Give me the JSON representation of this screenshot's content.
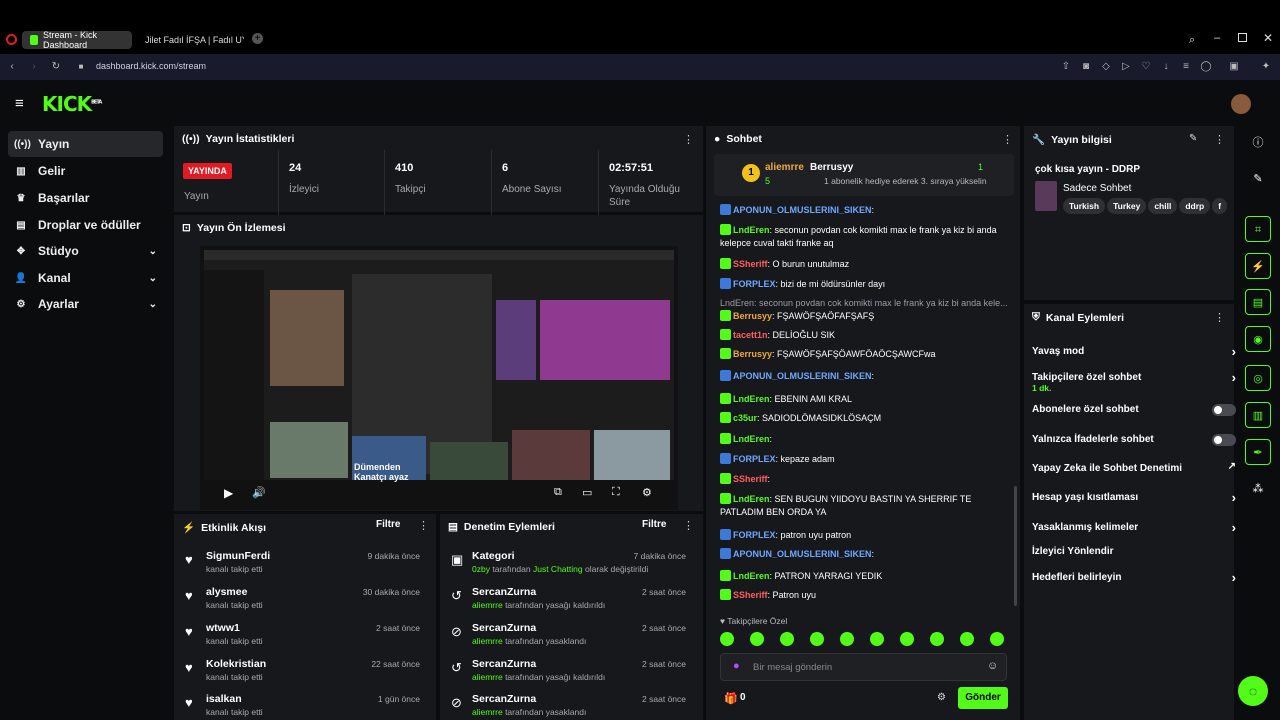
{
  "browser": {
    "tabs": [
      {
        "label": "Stream - Kick Dashboard"
      },
      {
        "label": "Jilet Fadıl İFŞA | Fadıl UYU"
      }
    ],
    "url_host": "dashboard.kick.com",
    "url_path": "/stream"
  },
  "sidebar": {
    "items": [
      {
        "label": "Yayın"
      },
      {
        "label": "Gelir"
      },
      {
        "label": "Başarılar"
      },
      {
        "label": "Droplar ve ödüller"
      },
      {
        "label": "Stüdyo"
      },
      {
        "label": "Kanal"
      },
      {
        "label": "Ayarlar"
      }
    ]
  },
  "logo": {
    "text": "KICK",
    "sup": "BETA"
  },
  "stats": {
    "title": "Yayın İstatistikleri",
    "live_badge": "YAYINDA",
    "items": [
      {
        "value": "",
        "label": "Yayın"
      },
      {
        "value": "24",
        "label": "İzleyici"
      },
      {
        "value": "410",
        "label": "Takipçi"
      },
      {
        "value": "6",
        "label": "Abone Sayısı"
      },
      {
        "value": "02:57:51",
        "label": "Yayında Olduğu Süre"
      }
    ]
  },
  "preview": {
    "title": "Yayın Ön İzlemesi",
    "overlay_text": "Dümenden Kanatçı ayaz"
  },
  "activity": {
    "title": "Etkinlik Akışı",
    "filter": "Filtre",
    "items": [
      {
        "name": "SigmunFerdi",
        "sub": "kanalı takip etti",
        "time": "9 dakika önce"
      },
      {
        "name": "alysmee",
        "sub": "kanalı takip etti",
        "time": "30 dakika önce"
      },
      {
        "name": "wtww1",
        "sub": "kanalı takip etti",
        "time": "2 saat önce"
      },
      {
        "name": "Kolekristian",
        "sub": "kanalı takip etti",
        "time": "22 saat önce"
      },
      {
        "name": "isalkan",
        "sub": "kanalı takip etti",
        "time": "1 gün önce"
      }
    ]
  },
  "moderation": {
    "title": "Denetim Eylemleri",
    "filter": "Filtre",
    "items": [
      {
        "name": "Kategori",
        "who": "0zby",
        "mid": " tarafından ",
        "what": "Just Chatting",
        "tail": " olarak değiştirildi",
        "time": "7 dakika önce"
      },
      {
        "name": "SercanZurna",
        "who": "aliemrre",
        "mid": " tarafından yasağı kaldırıldı",
        "what": "",
        "tail": "",
        "time": "2 saat önce"
      },
      {
        "name": "SercanZurna",
        "who": "aliemrre",
        "mid": " tarafından yasaklandı",
        "what": "",
        "tail": "",
        "time": "2 saat önce"
      },
      {
        "name": "SercanZurna",
        "who": "aliemrre",
        "mid": " tarafından yasağı kaldırıldı",
        "what": "",
        "tail": "",
        "time": "2 saat önce"
      },
      {
        "name": "SercanZurna",
        "who": "aliemrre",
        "mid": " tarafından yasaklandı",
        "what": "",
        "tail": "",
        "time": "2 saat önce"
      }
    ]
  },
  "chat": {
    "title": "Sohbet",
    "pinned": {
      "rank": "1",
      "user1": "aliemrre",
      "count1": "5",
      "user2": "Berrusyy",
      "count2": "1",
      "note": "1 abonelik hediye ederek 3. sıraya yükselin"
    },
    "messages": [
      {
        "user": "APONUN_OLMUSLERINI_SIKEN",
        "text": "",
        "color": "b"
      },
      {
        "user": "LndEren",
        "text": "seconun povdan cok komikti max le frank ya kiz bi anda kelepce cuval takti franke aq",
        "color": "g"
      },
      {
        "user": "SSheriff",
        "text": "O burun unutulmaz",
        "color": "r"
      },
      {
        "user": "FORPLEX",
        "text": "bizi de mi öldürsünler dayı",
        "color": "b"
      },
      {
        "user": "",
        "text": "LndEren: seconun povdan cok komikti max le frank ya kiz bi anda kele...",
        "color": "gr"
      },
      {
        "user": "Berrusyy",
        "text": "FŞAWÖFŞAÖFAFŞAFŞ",
        "color": "o"
      },
      {
        "user": "tacett1n",
        "text": "DELİOĞLU SIK",
        "color": "r"
      },
      {
        "user": "Berrusyy",
        "text": "FŞAWÖFŞAFŞÖAWFÖAÖCŞAWCFwa",
        "color": "o"
      },
      {
        "user": "APONUN_OLMUSLERINI_SIKEN",
        "text": "",
        "color": "b"
      },
      {
        "user": "LndEren",
        "text": "EBENIN AMI KRAL",
        "color": "g"
      },
      {
        "user": "c35ur",
        "text": "SADIODLÖMASIDKLÖSAÇM",
        "color": "g"
      },
      {
        "user": "LndEren",
        "text": "",
        "color": "g"
      },
      {
        "user": "FORPLEX",
        "text": "kepaze adam",
        "color": "b"
      },
      {
        "user": "SSheriff",
        "text": "",
        "color": "r"
      },
      {
        "user": "LndEren",
        "text": "SEN BUGUN YIIDOYU BASTIN YA SHERRIF TE PATLADIM BEN ORDA YA",
        "color": "g"
      },
      {
        "user": "FORPLEX",
        "text": "patron uyu patron",
        "color": "b"
      },
      {
        "user": "APONUN_OLMUSLERINI_SIKEN",
        "text": "",
        "color": "b"
      },
      {
        "user": "LndEren",
        "text": "PATRON YARRAGI YEDIK",
        "color": "g"
      },
      {
        "user": "SSheriff",
        "text": "Patron uyu",
        "color": "r"
      }
    ],
    "followers_only": "Takipçilere Özel",
    "placeholder": "Bir mesaj gönderin",
    "send": "Gönder",
    "count": "0"
  },
  "info": {
    "title": "Yayın bilgisi",
    "stream_title": "çok kısa yayın - DDRP",
    "category": "Sadece Sohbet",
    "tags": [
      "Turkish",
      "Turkey",
      "chill",
      "ddrp",
      "f"
    ]
  },
  "actions": {
    "title": "Kanal Eylemleri",
    "items": [
      {
        "label": "Yavaş mod",
        "sub": "",
        "kind": "chevron"
      },
      {
        "label": "Takipçilere özel sohbet",
        "sub": "1 dk.",
        "kind": "chevron"
      },
      {
        "label": "Abonelere özel sohbet",
        "sub": "",
        "kind": "toggle"
      },
      {
        "label": "Yalnızca İfadelerle sohbet",
        "sub": "",
        "kind": "toggle"
      },
      {
        "label": "Yapay Zeka ile Sohbet Denetimi",
        "sub": "",
        "kind": "external"
      },
      {
        "label": "Hesap yaşı kısıtlaması",
        "sub": "",
        "kind": "chevron"
      },
      {
        "label": "Yasaklanmış kelimeler",
        "sub": "",
        "kind": "chevron"
      },
      {
        "label": "İzleyici Yönlendir",
        "sub": "",
        "kind": "none"
      },
      {
        "label": "Hedefleri belirleyin",
        "sub": "",
        "kind": "chevron"
      }
    ]
  },
  "colors": {
    "accent": "#53fc18",
    "live": "#e01b24",
    "panel": "#17181b"
  }
}
